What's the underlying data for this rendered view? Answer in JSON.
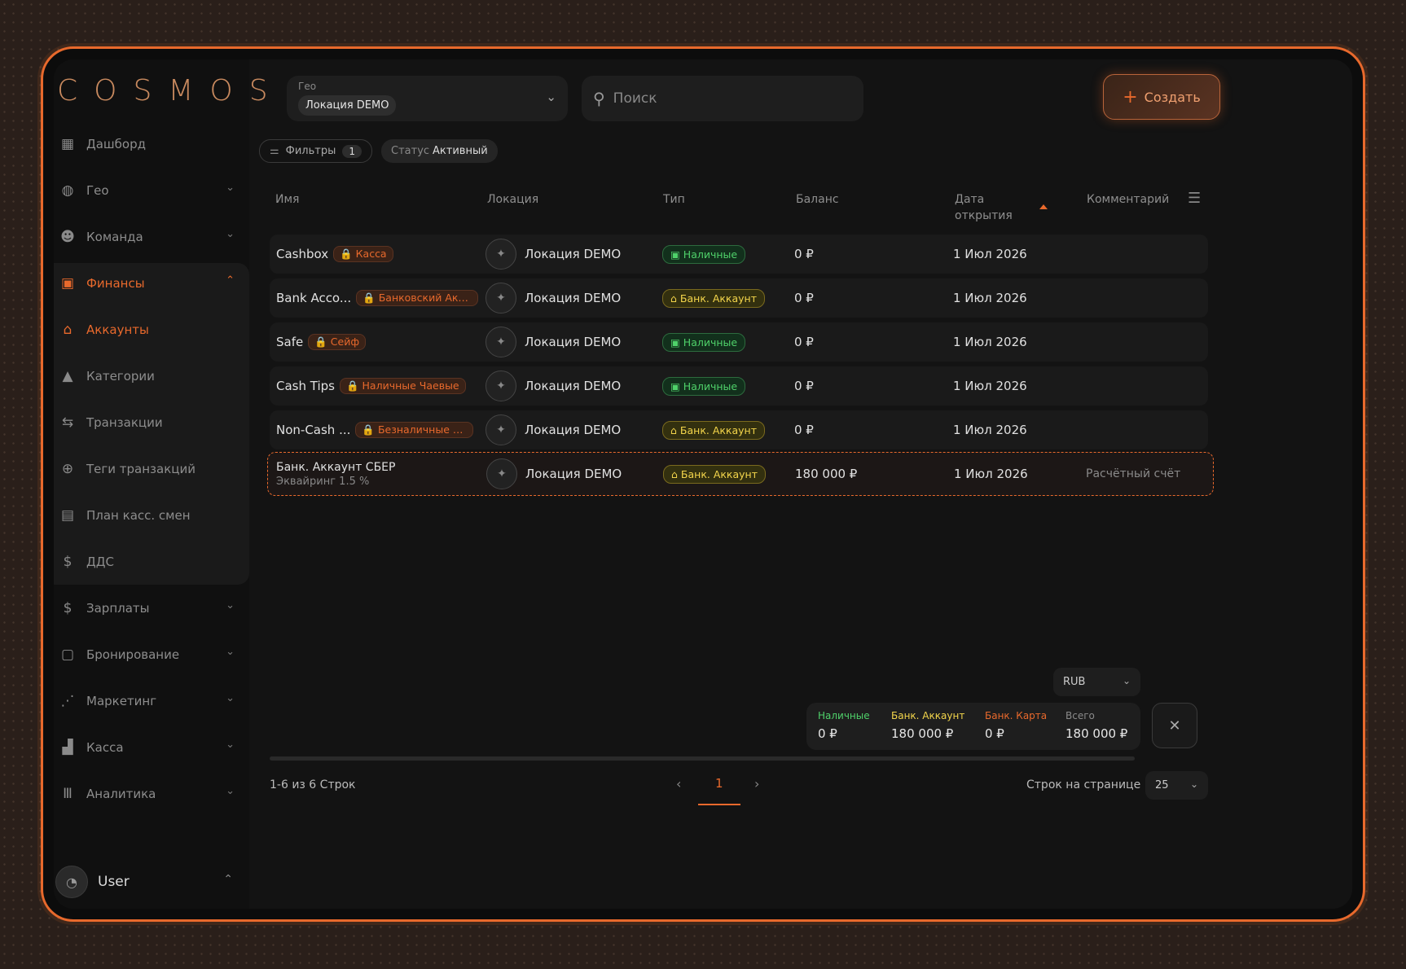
{
  "app": {
    "logo": "COSMOS"
  },
  "sidebar": {
    "items": [
      {
        "label": "Дашборд",
        "icon": "dashboard-icon",
        "chevron": false,
        "state": "normal"
      },
      {
        "label": "Гео",
        "icon": "globe-icon",
        "chevron": true,
        "state": "normal"
      },
      {
        "label": "Команда",
        "icon": "team-icon",
        "chevron": true,
        "state": "normal"
      },
      {
        "label": "Финансы",
        "icon": "money-icon",
        "chevron": true,
        "state": "expanded"
      },
      {
        "label": "Аккаунты",
        "icon": "bank-icon",
        "chevron": false,
        "state": "active"
      },
      {
        "label": "Категории",
        "icon": "shapes-icon",
        "chevron": false,
        "state": "normal"
      },
      {
        "label": "Транзакции",
        "icon": "transfer-icon",
        "chevron": false,
        "state": "normal"
      },
      {
        "label": "Теги транзакций",
        "icon": "tag-icon",
        "chevron": false,
        "state": "normal"
      },
      {
        "label": "План касс. смен",
        "icon": "calendar-icon",
        "chevron": false,
        "state": "normal"
      },
      {
        "label": "ДДС",
        "icon": "coin-icon",
        "chevron": false,
        "state": "normal"
      },
      {
        "label": "Зарплаты",
        "icon": "salary-icon",
        "chevron": true,
        "state": "normal"
      },
      {
        "label": "Бронирование",
        "icon": "booking-icon",
        "chevron": true,
        "state": "normal"
      },
      {
        "label": "Маркетинг",
        "icon": "chart-icon",
        "chevron": true,
        "state": "normal"
      },
      {
        "label": "Касса",
        "icon": "register-icon",
        "chevron": true,
        "state": "normal"
      },
      {
        "label": "Аналитика",
        "icon": "analytics-icon",
        "chevron": true,
        "state": "normal"
      }
    ],
    "user": "User"
  },
  "header": {
    "geo_label": "Гео",
    "geo_value": "Локация DEMO",
    "search_placeholder": "Поиск",
    "create_label": "Создать"
  },
  "filters": {
    "label": "Фильтры",
    "count": "1",
    "status_key": "Статус",
    "status_value": "Активный"
  },
  "table": {
    "columns": [
      "Имя",
      "Локация",
      "Тип",
      "Баланс",
      "Дата\nоткрытия",
      "Комментарий"
    ],
    "rows": [
      {
        "name": "Cashbox",
        "tag": "Касса",
        "location": "Локация DEMO",
        "type": "Наличные",
        "type_kind": "cash",
        "balance": "0 ₽",
        "date": "1 Июл 2026",
        "comment": ""
      },
      {
        "name": "Bank Acco...",
        "tag": "Банковский Акк...",
        "location": "Локация DEMO",
        "type": "Банк. Аккаунт",
        "type_kind": "bank",
        "balance": "0 ₽",
        "date": "1 Июл 2026",
        "comment": ""
      },
      {
        "name": "Safe",
        "tag": "Сейф",
        "location": "Локация DEMO",
        "type": "Наличные",
        "type_kind": "cash",
        "balance": "0 ₽",
        "date": "1 Июл 2026",
        "comment": ""
      },
      {
        "name": "Cash Tips",
        "tag": "Наличные Чаевые",
        "location": "Локация DEMO",
        "type": "Наличные",
        "type_kind": "cash",
        "balance": "0 ₽",
        "date": "1 Июл 2026",
        "comment": ""
      },
      {
        "name": "Non-Cash ...",
        "tag": "Безналичные Ч...",
        "location": "Локация DEMO",
        "type": "Банк. Аккаунт",
        "type_kind": "bank",
        "balance": "0 ₽",
        "date": "1 Июл 2026",
        "comment": ""
      },
      {
        "name": "Банк. Аккаунт СБЕР",
        "subtitle": "Эквайринг 1.5 %",
        "location": "Локация DEMO",
        "type": "Банк. Аккаунт",
        "type_kind": "bank",
        "balance": "180 000 ₽",
        "date": "1 Июл 2026",
        "comment": "Расчётный счёт"
      }
    ]
  },
  "totals": {
    "currency": "RUB",
    "items": [
      {
        "label": "Наличные",
        "value": "0 ₽",
        "color": "#4fd16a"
      },
      {
        "label": "Банк. Аккаунт",
        "value": "180 000 ₽",
        "color": "#f3d54b"
      },
      {
        "label": "Банк. Карта",
        "value": "0 ₽",
        "color": "#e8692c"
      },
      {
        "label": "Всего",
        "value": "180 000 ₽",
        "color": "#8a8a8a"
      }
    ]
  },
  "pagination": {
    "count_text": "1-6 из 6 Строк",
    "current_page": "1",
    "rows_per_page_label": "Строк на странице",
    "rows_per_page": "25"
  },
  "colors": {
    "accent": "#e8692c",
    "cash": "#4fd16a",
    "bank": "#f3d54b"
  }
}
